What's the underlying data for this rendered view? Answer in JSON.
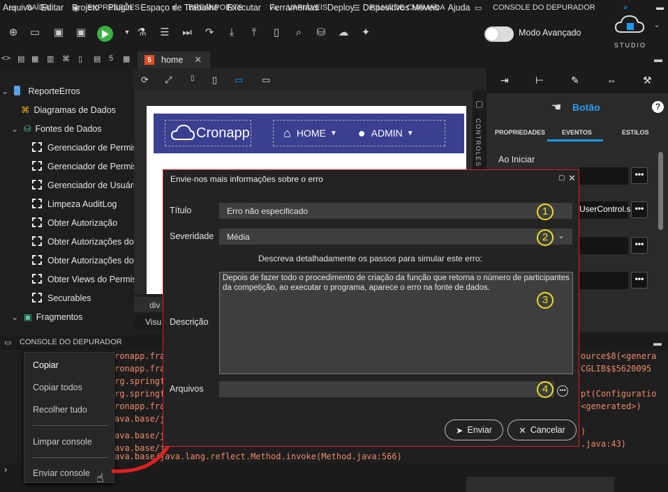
{
  "menu": [
    "Arquivo",
    "Editar",
    "Projeto",
    "Plugin",
    "Espaço de Trabalho",
    "Executar",
    "Ferramentas",
    "Deploy",
    "Dispositivos Móveis",
    "Ajuda"
  ],
  "toolbar": {
    "mode_label": "Modo Avançado",
    "studio_label": "STUDIO"
  },
  "tree": {
    "project": "ReporteErros",
    "items": [
      "Diagramas de Dados",
      "Fontes de Dados",
      "Gerenciador de Permis",
      "Gerenciador de Permis",
      "Gerenciador de Usuári",
      "Limpeza AuditLog",
      "Obter Autorização",
      "Obter Autorizações do",
      "Obter Autorizações do",
      "Obter Views do Permis",
      "Securables",
      "Fragmentos"
    ]
  },
  "editor": {
    "tab_icon": "5",
    "tab_label": "home",
    "logo_text": "Cronapp",
    "nav_home": "HOME",
    "nav_admin": "ADMIN",
    "controles_label": "CONTROLES",
    "div_tab": "div",
    "visu_tab": "Visu"
  },
  "right_panel": {
    "component": "Botão",
    "tabs": [
      "PROPRIEDADES",
      "EVENTOS",
      "ESTILOS"
    ],
    "active_tab": "EVENTOS",
    "event_label": "Ao Iniciar",
    "user_control": "UserControl.s",
    "dots": "•••"
  },
  "console": {
    "header": "CONSOLE DO DEPURADOR",
    "left_lines": [
      "ronapp.fra",
      "ronapp.fra",
      "rg.springf",
      "rg.springf",
      "ronapp.fra",
      "ava.base/j",
      "ava.base/j",
      "ava.base/j"
    ],
    "right_lines": [
      "ource$8(<genera",
      "CGLIB$$5620095",
      "",
      "pt(Configuratio",
      "<generated>)",
      "",
      ")",
      ".java:43)"
    ],
    "last_line": "ava.base/java.lang.reflect.Method.invoke(Method.java:566)",
    "prompt": "›"
  },
  "context_menu": [
    "Copiar",
    "Copiar todos",
    "Recolher tudo",
    "Limpar console",
    "Enviar console"
  ],
  "bottom_tabs": [
    "SAÍDA",
    "EXPRESSÕES",
    "BREAKPOINTS",
    "VARIÁVEIS",
    "PILHA DE CHAMADA",
    "CONSOLE DO DEPURADOR"
  ],
  "dialog": {
    "title": "Envie-nos mais informações sobre o erro",
    "titulo_label": "Título",
    "titulo_value": "Erro não especificado",
    "severidade_label": "Severidade",
    "severidade_value": "Média",
    "instructions": "Descreva detalhadamente os passos para simular este erro:",
    "descricao_label": "Descrição",
    "descricao_value": "Depois de fazer todo o procedimento de criação da função que retorna o número de participantes da competição, ao executar o programa, aparece o erro na fonte de dados.",
    "arquivos_label": "Arquivos",
    "send_button": "Enviar",
    "cancel_button": "Cancelar",
    "markers": [
      "1",
      "2",
      "3",
      "4"
    ]
  },
  "colors": {
    "accent": "#0f8ee0",
    "play": "#3cb043",
    "dialog_border": "#e02020",
    "marker": "#f0e020",
    "console_text": "#f08a6c",
    "navbar": "#3a3f90"
  }
}
